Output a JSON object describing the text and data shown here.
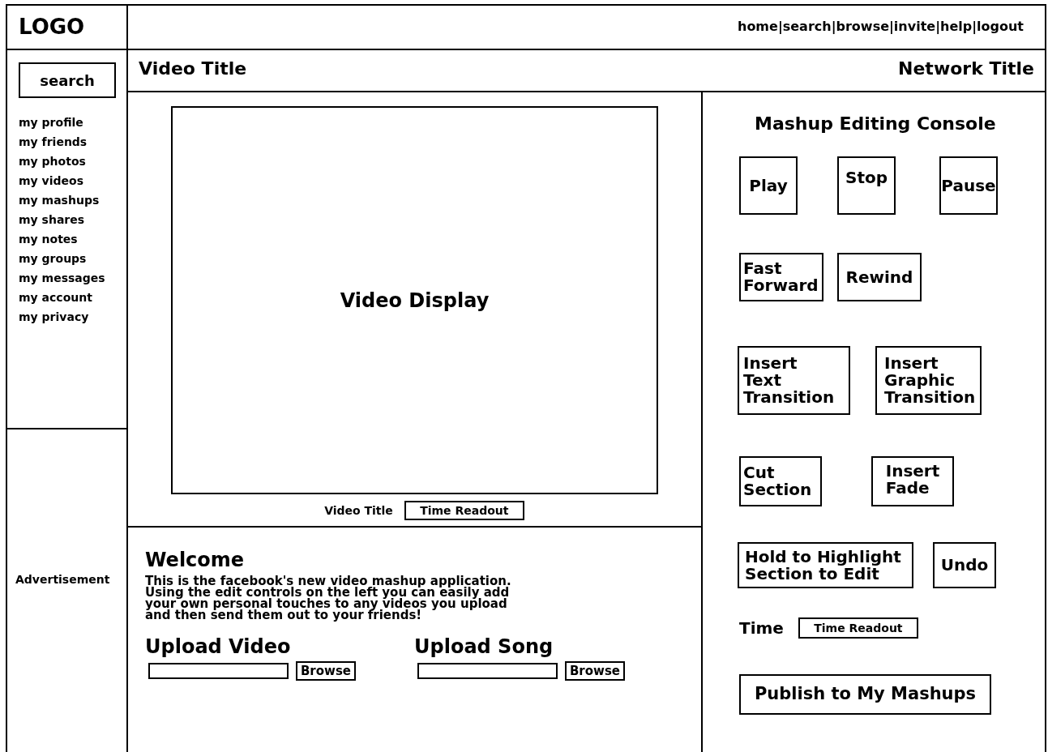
{
  "logo": "LOGO",
  "top_nav": [
    {
      "label": "home",
      "separator": "|"
    },
    {
      "label": "search",
      "separator": "|"
    },
    {
      "label": "browse",
      "separator": "|"
    },
    {
      "label": "invite",
      "separator": "|"
    },
    {
      "label": "help",
      "separator": "|"
    },
    {
      "label": "logout"
    }
  ],
  "sidebar": {
    "search_button": "search",
    "items": [
      "my profile",
      "my friends",
      "my photos",
      "my videos",
      "my mashups",
      "my shares",
      "my notes",
      "my groups",
      "my messages",
      "my account",
      "my privacy"
    ],
    "advertisement": "Advertisement"
  },
  "title_bar": {
    "video_title": "Video Title",
    "network_title": "Network Title"
  },
  "video": {
    "display": "Video Display",
    "caption": "Video Title",
    "time_readout": "Time Readout"
  },
  "welcome": {
    "heading": "Welcome",
    "text": "This is the facebook's new video mashup application.\nUsing the edit controls on the left you can easily add\nyour own personal touches to any videos you upload\nand then send them out to your friends!",
    "uploads": [
      {
        "label": "Upload Video",
        "button": "Browse"
      },
      {
        "label": "Upload Song",
        "button": "Browse"
      }
    ]
  },
  "console": {
    "title": "Mashup Editing Console",
    "rows": [
      [
        "Play",
        "Stop",
        "Pause"
      ],
      [
        "Fast\nForward",
        "Rewind"
      ],
      [
        "Insert\nText\nTransition",
        "Insert\nGraphic\nTransition"
      ],
      [
        "Cut\nSection",
        "Insert\nFade"
      ],
      [
        "Hold to Highlight\nSection to Edit",
        "Undo"
      ]
    ],
    "time_label": "Time",
    "time_readout": "Time Readout",
    "publish": "Publish to My Mashups"
  }
}
